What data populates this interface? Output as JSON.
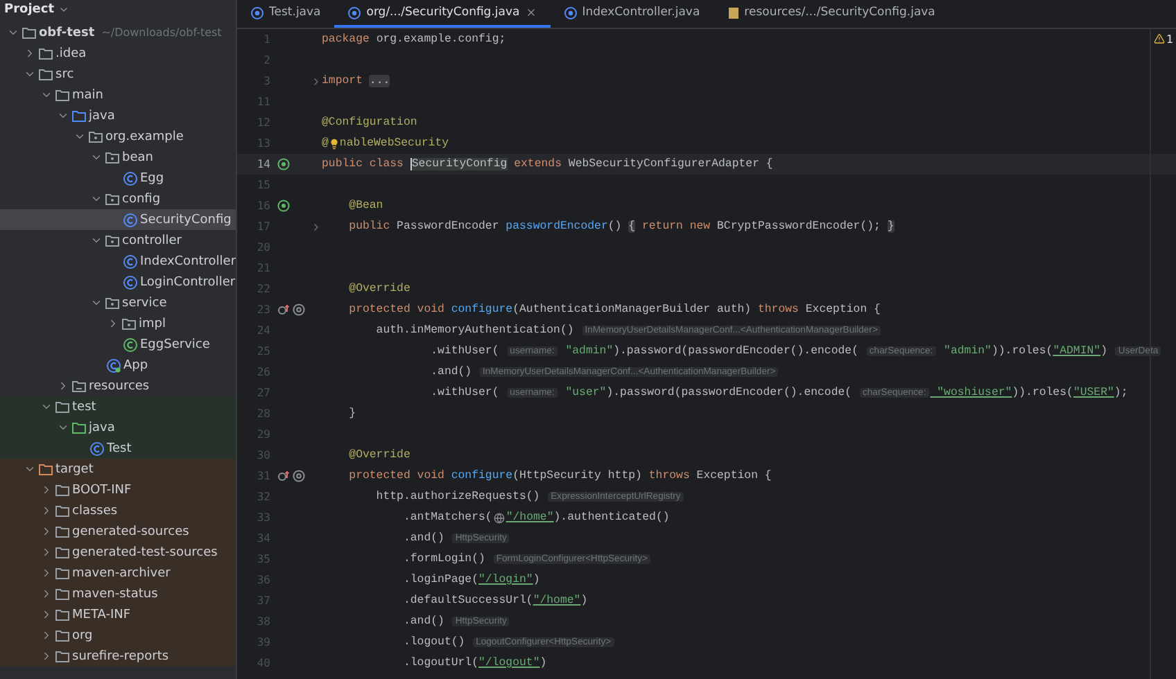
{
  "sidebar": {
    "title": "Project",
    "tree": [
      {
        "label": "obf-test",
        "path": "~/Downloads/obf-test",
        "kind": "module",
        "expanded": true,
        "selected": false,
        "children": [
          {
            "label": ".idea",
            "kind": "folder",
            "expanded": false,
            "selected": false
          },
          {
            "label": "src",
            "kind": "folder",
            "expanded": true,
            "selected": false,
            "children": [
              {
                "label": "main",
                "kind": "folder",
                "expanded": true,
                "selected": false,
                "children": [
                  {
                    "label": "java",
                    "kind": "source",
                    "expanded": true,
                    "selected": false,
                    "children": [
                      {
                        "label": "org.example",
                        "kind": "package",
                        "expanded": true,
                        "selected": false,
                        "children": [
                          {
                            "label": "bean",
                            "kind": "package",
                            "expanded": true,
                            "selected": false,
                            "children": [
                              {
                                "label": "Egg",
                                "kind": "class",
                                "selected": false
                              }
                            ]
                          },
                          {
                            "label": "config",
                            "kind": "package",
                            "expanded": true,
                            "selected": false,
                            "children": [
                              {
                                "label": "SecurityConfig",
                                "kind": "class",
                                "selected": true
                              }
                            ]
                          },
                          {
                            "label": "controller",
                            "kind": "package",
                            "expanded": true,
                            "selected": false,
                            "children": [
                              {
                                "label": "IndexController",
                                "kind": "class",
                                "selected": false
                              },
                              {
                                "label": "LoginController",
                                "kind": "class",
                                "selected": false
                              }
                            ]
                          },
                          {
                            "label": "service",
                            "kind": "package",
                            "expanded": true,
                            "selected": false,
                            "children": [
                              {
                                "label": "impl",
                                "kind": "package",
                                "expanded": false,
                                "selected": false
                              },
                              {
                                "label": "EggService",
                                "kind": "interface",
                                "selected": false
                              }
                            ]
                          },
                          {
                            "label": "App",
                            "kind": "app",
                            "selected": false
                          }
                        ]
                      }
                    ]
                  },
                  {
                    "label": "resources",
                    "kind": "resources",
                    "expanded": false,
                    "selected": false
                  }
                ]
              },
              {
                "label": "test",
                "kind": "test-folder",
                "expanded": true,
                "selected": false,
                "children": [
                  {
                    "label": "java",
                    "kind": "test-source",
                    "expanded": true,
                    "selected": false,
                    "children": [
                      {
                        "label": "Test",
                        "kind": "class",
                        "selected": false
                      }
                    ]
                  }
                ]
              }
            ]
          },
          {
            "label": "target",
            "kind": "excluded",
            "expanded": true,
            "selected": false,
            "children": [
              {
                "label": "BOOT-INF",
                "kind": "folder",
                "expanded": false,
                "selected": false
              },
              {
                "label": "classes",
                "kind": "folder",
                "expanded": false,
                "selected": false
              },
              {
                "label": "generated-sources",
                "kind": "folder",
                "expanded": false,
                "selected": false
              },
              {
                "label": "generated-test-sources",
                "kind": "folder",
                "expanded": false,
                "selected": false
              },
              {
                "label": "maven-archiver",
                "kind": "folder",
                "expanded": false,
                "selected": false
              },
              {
                "label": "maven-status",
                "kind": "folder",
                "expanded": false,
                "selected": false
              },
              {
                "label": "META-INF",
                "kind": "folder",
                "expanded": false,
                "selected": false
              },
              {
                "label": "org",
                "kind": "folder",
                "expanded": false,
                "selected": false
              },
              {
                "label": "surefire-reports",
                "kind": "folder",
                "expanded": false,
                "selected": false
              }
            ]
          }
        ]
      }
    ]
  },
  "tabs": [
    {
      "label": "Test.java",
      "kind": "test",
      "selected": false
    },
    {
      "label": "org/.../SecurityConfig.java",
      "kind": "class",
      "selected": true
    },
    {
      "label": "IndexController.java",
      "kind": "class",
      "selected": false
    },
    {
      "label": "resources/.../SecurityConfig.java",
      "kind": "resource",
      "selected": false
    }
  ],
  "warnings": {
    "count": "1"
  },
  "editor": {
    "lines": [
      {
        "number": "1",
        "current": false,
        "tokens": [
          {
            "kind": "keyword",
            "text": "package"
          },
          {
            "kind": "plain",
            "text": " org.example.config;"
          }
        ]
      },
      {
        "number": "2",
        "current": false
      },
      {
        "number": "3",
        "current": false,
        "gutter": [
          {
            "kind": "fold"
          }
        ],
        "tokens": [
          {
            "kind": "keyword",
            "text": "import "
          },
          {
            "kind": "folded",
            "text": "..."
          }
        ]
      },
      {
        "number": "11",
        "current": false
      },
      {
        "number": "12",
        "current": false,
        "tokens": [
          {
            "kind": "annotation",
            "text": "@Configuration"
          }
        ]
      },
      {
        "number": "13",
        "current": false,
        "tokens": [
          {
            "kind": "annotation",
            "text": "@"
          },
          {
            "kind": "bulb"
          },
          {
            "kind": "annotation",
            "text": "nableWebSecurity"
          }
        ]
      },
      {
        "number": "14",
        "current": true,
        "gutter": [
          {
            "kind": "bean"
          }
        ],
        "tokens": [
          {
            "kind": "keyword",
            "text": "public class "
          },
          {
            "kind": "caret-ident",
            "text": "SecurityConfig"
          },
          {
            "kind": "keyword",
            "text": " extends "
          },
          {
            "kind": "plain",
            "text": "WebSecurityConfigurerAdapter {"
          }
        ]
      },
      {
        "number": "15",
        "current": false
      },
      {
        "number": "16",
        "current": false,
        "gutter": [
          {
            "kind": "bean"
          }
        ],
        "tokens": [
          {
            "kind": "annotation",
            "text": "    @Bean"
          }
        ]
      },
      {
        "number": "17",
        "current": false,
        "gutter": [
          {
            "kind": "fold"
          }
        ],
        "tokens": [
          {
            "kind": "keyword",
            "text": "    public "
          },
          {
            "kind": "plain",
            "text": "PasswordEncoder "
          },
          {
            "kind": "method",
            "text": "passwordEncoder"
          },
          {
            "kind": "plain",
            "text": "() "
          },
          {
            "kind": "folded",
            "text": "{"
          },
          {
            "kind": "keyword",
            "text": " return new "
          },
          {
            "kind": "plain",
            "text": "BCryptPasswordEncoder(); "
          },
          {
            "kind": "folded",
            "text": "}"
          }
        ]
      },
      {
        "number": "20",
        "current": false
      },
      {
        "number": "21",
        "current": false
      },
      {
        "number": "22",
        "current": false,
        "tokens": [
          {
            "kind": "annotation",
            "text": "    @Override"
          }
        ]
      },
      {
        "number": "23",
        "current": false,
        "gutter": [
          {
            "kind": "override"
          },
          {
            "kind": "web"
          }
        ],
        "tokens": [
          {
            "kind": "keyword",
            "text": "    protected void "
          },
          {
            "kind": "method",
            "text": "configure"
          },
          {
            "kind": "plain",
            "text": "(AuthenticationManagerBuilder auth) "
          },
          {
            "kind": "keyword",
            "text": "throws "
          },
          {
            "kind": "plain",
            "text": "Exception {"
          }
        ]
      },
      {
        "number": "24",
        "current": false,
        "tokens": [
          {
            "kind": "plain",
            "text": "        auth.inMemoryAuthentication() "
          },
          {
            "kind": "hint",
            "text": "InMemoryUserDetailsManagerConf...<AuthenticationManagerBuilder>"
          }
        ]
      },
      {
        "number": "25",
        "current": false,
        "tokens": [
          {
            "kind": "plain",
            "text": "                .withUser( "
          },
          {
            "kind": "hint",
            "text": "username:"
          },
          {
            "kind": "string",
            "text": " \"admin\""
          },
          {
            "kind": "plain",
            "text": ").password(passwordEncoder().encode( "
          },
          {
            "kind": "hint",
            "text": "charSequence:"
          },
          {
            "kind": "string",
            "text": " \"admin\""
          },
          {
            "kind": "plain",
            "text": ")).roles("
          },
          {
            "kind": "link",
            "text": "\"ADMIN\""
          },
          {
            "kind": "plain",
            "text": ") "
          },
          {
            "kind": "hint",
            "text": "UserDeta"
          }
        ]
      },
      {
        "number": "26",
        "current": false,
        "tokens": [
          {
            "kind": "plain",
            "text": "                .and() "
          },
          {
            "kind": "hint",
            "text": "InMemoryUserDetailsManagerConf...<AuthenticationManagerBuilder>"
          }
        ]
      },
      {
        "number": "27",
        "current": false,
        "tokens": [
          {
            "kind": "plain",
            "text": "                .withUser( "
          },
          {
            "kind": "hint",
            "text": "username:"
          },
          {
            "kind": "string",
            "text": " \"user\""
          },
          {
            "kind": "plain",
            "text": ").password(passwordEncoder().encode( "
          },
          {
            "kind": "hint",
            "text": "charSequence:"
          },
          {
            "kind": "link",
            "text": " \"woshiuser\""
          },
          {
            "kind": "plain",
            "text": ")).roles("
          },
          {
            "kind": "link",
            "text": "\"USER\""
          },
          {
            "kind": "plain",
            "text": ");"
          }
        ]
      },
      {
        "number": "28",
        "current": false,
        "tokens": [
          {
            "kind": "plain",
            "text": "    }"
          }
        ]
      },
      {
        "number": "29",
        "current": false
      },
      {
        "number": "30",
        "current": false,
        "tokens": [
          {
            "kind": "annotation",
            "text": "    @Override"
          }
        ]
      },
      {
        "number": "31",
        "current": false,
        "gutter": [
          {
            "kind": "override"
          },
          {
            "kind": "web"
          }
        ],
        "tokens": [
          {
            "kind": "keyword",
            "text": "    protected void "
          },
          {
            "kind": "method",
            "text": "configure"
          },
          {
            "kind": "plain",
            "text": "(HttpSecurity http) "
          },
          {
            "kind": "keyword",
            "text": "throws "
          },
          {
            "kind": "plain",
            "text": "Exception {"
          }
        ]
      },
      {
        "number": "32",
        "current": false,
        "tokens": [
          {
            "kind": "plain",
            "text": "        http.authorizeRequests() "
          },
          {
            "kind": "hint",
            "text": "ExpressionInterceptUrlRegistry"
          }
        ]
      },
      {
        "number": "33",
        "current": false,
        "tokens": [
          {
            "kind": "plain",
            "text": "            .antMatchers("
          },
          {
            "kind": "globe"
          },
          {
            "kind": "link",
            "text": "\"/home\""
          },
          {
            "kind": "plain",
            "text": ").authenticated()"
          }
        ]
      },
      {
        "number": "34",
        "current": false,
        "tokens": [
          {
            "kind": "plain",
            "text": "            .and() "
          },
          {
            "kind": "hint",
            "text": "HttpSecurity"
          }
        ]
      },
      {
        "number": "35",
        "current": false,
        "tokens": [
          {
            "kind": "plain",
            "text": "            .formLogin() "
          },
          {
            "kind": "hint",
            "text": "FormLoginConfigurer<HttpSecurity>"
          }
        ]
      },
      {
        "number": "36",
        "current": false,
        "tokens": [
          {
            "kind": "plain",
            "text": "            .loginPage("
          },
          {
            "kind": "link",
            "text": "\"/login\""
          },
          {
            "kind": "plain",
            "text": ")"
          }
        ]
      },
      {
        "number": "37",
        "current": false,
        "tokens": [
          {
            "kind": "plain",
            "text": "            .defaultSuccessUrl("
          },
          {
            "kind": "link",
            "text": "\"/home\""
          },
          {
            "kind": "plain",
            "text": ")"
          }
        ]
      },
      {
        "number": "38",
        "current": false,
        "tokens": [
          {
            "kind": "plain",
            "text": "            .and() "
          },
          {
            "kind": "hint",
            "text": "HttpSecurity"
          }
        ]
      },
      {
        "number": "39",
        "current": false,
        "tokens": [
          {
            "kind": "plain",
            "text": "            .logout() "
          },
          {
            "kind": "hint",
            "text": "LogoutConfigurer<HttpSecurity>"
          }
        ]
      },
      {
        "number": "40",
        "current": false,
        "tokens": [
          {
            "kind": "plain",
            "text": "            .logoutUrl("
          },
          {
            "kind": "link",
            "text": "\"/logout\""
          },
          {
            "kind": "plain",
            "text": ")"
          }
        ]
      }
    ]
  }
}
